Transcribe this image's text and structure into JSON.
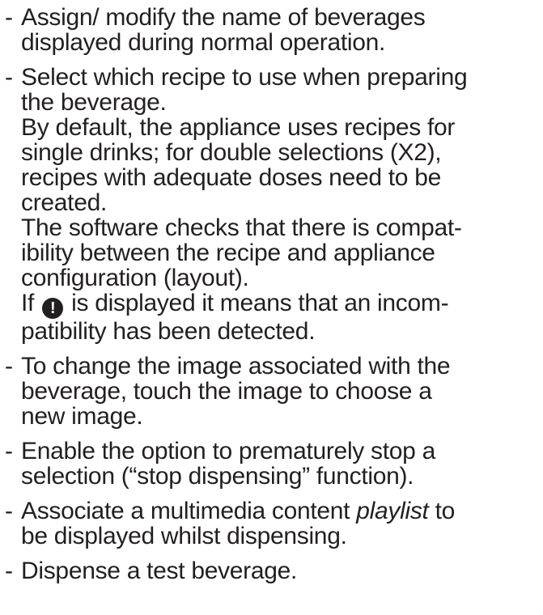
{
  "items": [
    {
      "dash": "-",
      "lines": [
        "Assign/ modify the name of beverages",
        "displayed during normal operation."
      ]
    },
    {
      "dash": "-",
      "lines": [
        "Select which recipe to use when preparing",
        "the beverage.",
        "By default, the appliance uses recipes for",
        "single drinks; for double selections (X2),",
        "recipes with adequate doses need to be",
        "created.",
        "The software checks that there is compat-",
        "ibility between the recipe and appliance",
        "configuration (layout)."
      ],
      "icon_line_before": "If",
      "icon_glyph": "!",
      "icon_line_after": "is displayed it means that an incom-",
      "last_line": "patibility has been detected."
    },
    {
      "dash": "-",
      "lines": [
        "To change the image associated with the",
        "beverage, touch the image to choose a",
        "new image."
      ]
    },
    {
      "dash": "-",
      "lines": [
        "Enable the option to prematurely stop a",
        "selection (“stop dispensing” function)."
      ]
    },
    {
      "dash": "-",
      "line1_before": "Associate a multimedia content",
      "line1_italic": "playlist",
      "line1_after": "to",
      "line2": "be displayed whilst dispensing."
    },
    {
      "dash": "-",
      "lines": [
        "Dispense a test beverage."
      ]
    }
  ]
}
